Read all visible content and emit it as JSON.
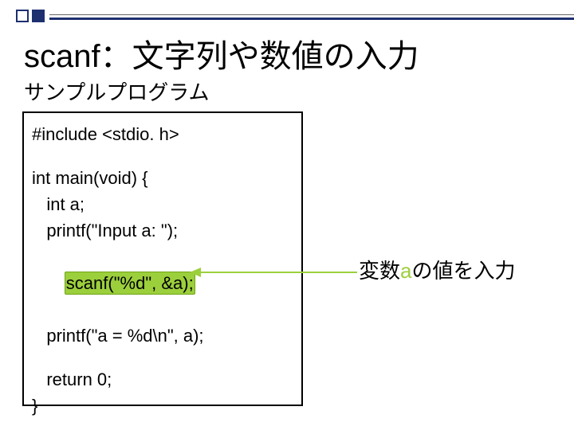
{
  "title": "scanf：文字列や数値の入力",
  "subtitle": "サンプルプログラム",
  "code": {
    "l1": "#include <stdio. h>",
    "l2": "int main(void) {",
    "l3": "   int a;",
    "l4": "   printf(\"Input a: \");",
    "l5_indent": "   ",
    "l5_hl": "scanf(\"%d\", &a);",
    "l6": "   printf(\"a = %d\\n\", a);",
    "l7": "   return 0;",
    "l8": "}"
  },
  "annotation": {
    "pre": "変数",
    "var": "a",
    "post": "の値を入力"
  },
  "colors": {
    "accent_green": "#9ccf3c",
    "accent_green_border": "#6fa514",
    "brand_navy": "#1d2f6f"
  }
}
